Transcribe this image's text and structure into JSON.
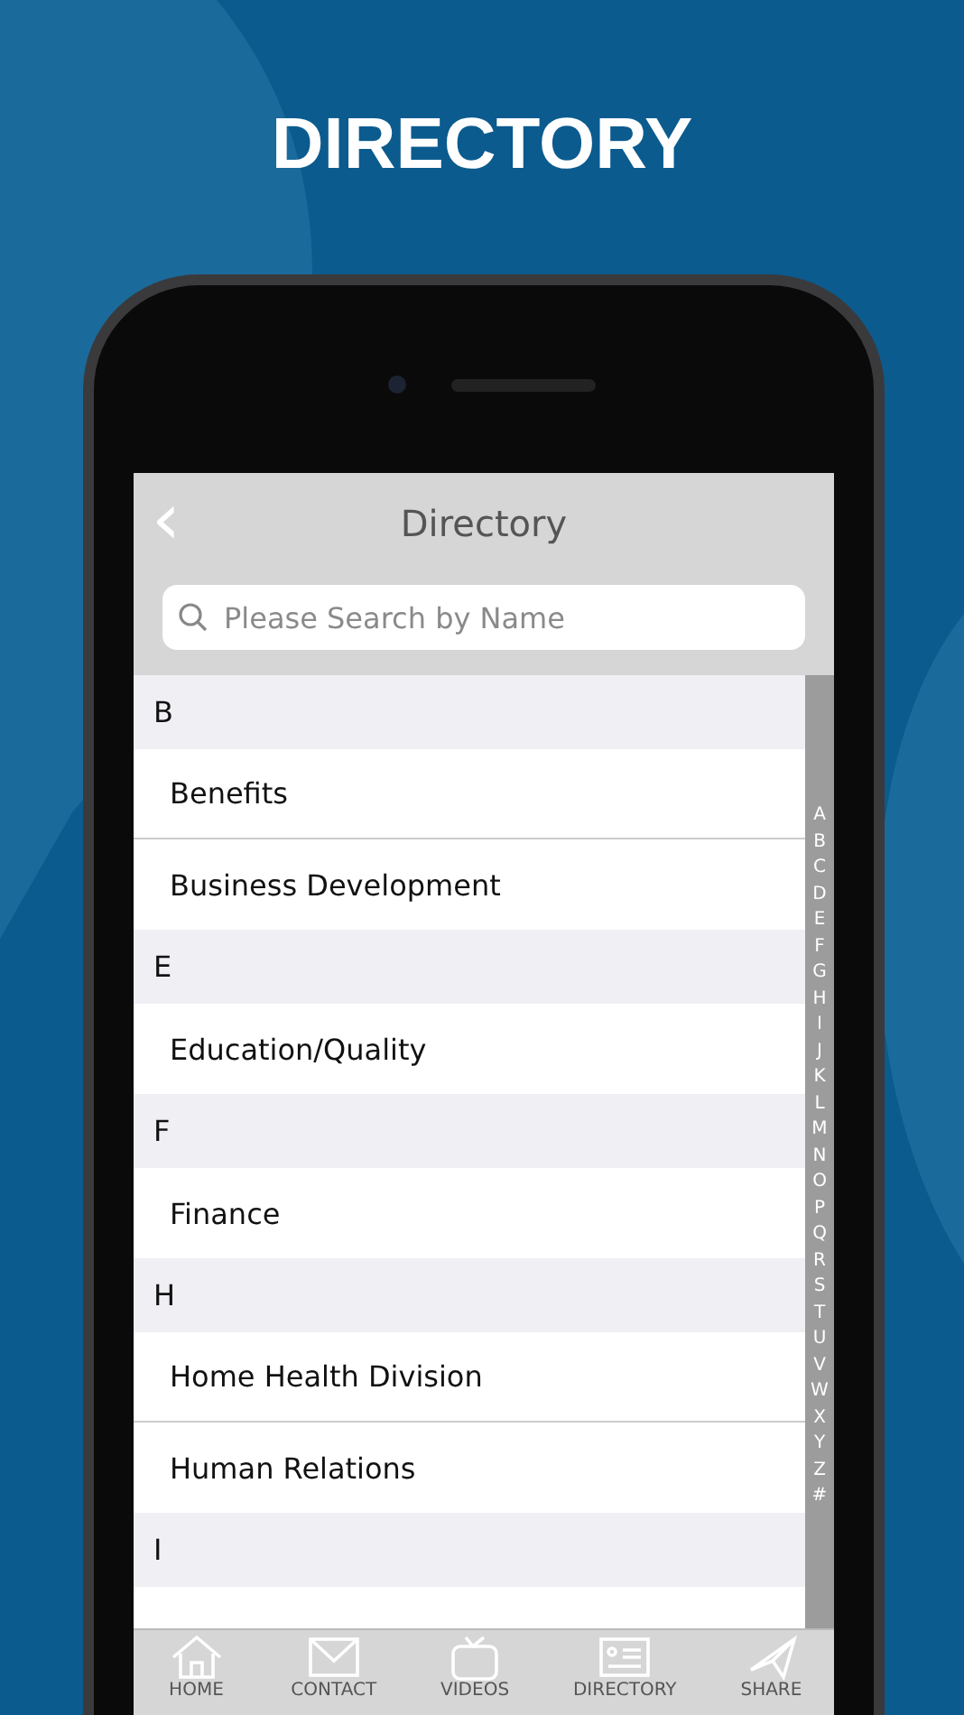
{
  "headline": "DIRECTORY",
  "header": {
    "back": "‹",
    "title": "Directory"
  },
  "search": {
    "placeholder": "Please Search by Name"
  },
  "sections": [
    {
      "letter": "B",
      "items": [
        "Benefits",
        "Business Development"
      ]
    },
    {
      "letter": "E",
      "items": [
        "Education/Quality"
      ]
    },
    {
      "letter": "F",
      "items": [
        "Finance"
      ]
    },
    {
      "letter": "H",
      "items": [
        "Home Health Division",
        "Human Relations"
      ]
    },
    {
      "letter": "I"
    }
  ],
  "index": [
    "A",
    "B",
    "C",
    "D",
    "E",
    "F",
    "G",
    "H",
    "I",
    "J",
    "K",
    "L",
    "M",
    "N",
    "O",
    "P",
    "Q",
    "R",
    "S",
    "T",
    "U",
    "V",
    "W",
    "X",
    "Y",
    "Z",
    "#"
  ],
  "tabs": [
    {
      "label": "HOME",
      "kind": "home"
    },
    {
      "label": "CONTACT",
      "kind": "contact"
    },
    {
      "label": "VIDEOS",
      "kind": "videos"
    },
    {
      "label": "DIRECTORY",
      "kind": "directory"
    },
    {
      "label": "SHARE",
      "kind": "share"
    }
  ]
}
